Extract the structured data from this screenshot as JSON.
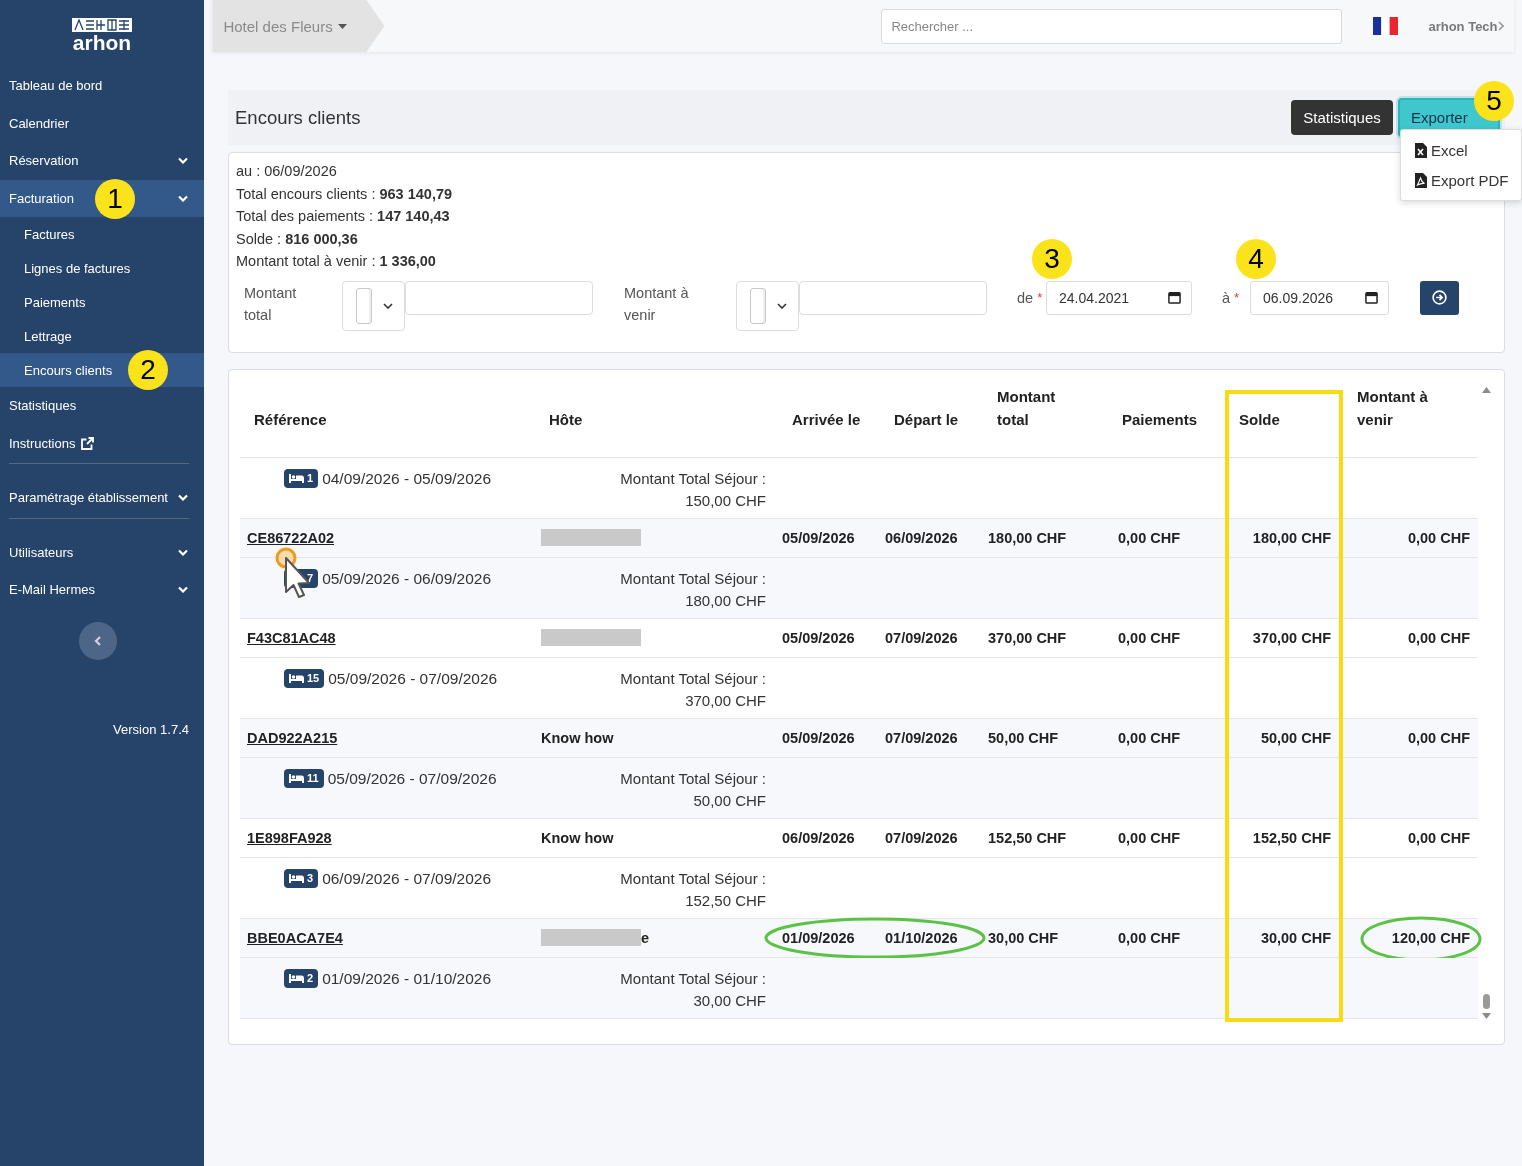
{
  "sidebar": {
    "logo": "arhon",
    "items": [
      {
        "label": "Tableau de bord",
        "kind": "link",
        "selected": false,
        "divider_before": false
      },
      {
        "label": "Calendrier",
        "kind": "link",
        "selected": false,
        "divider_before": false
      },
      {
        "label": "Réservation",
        "kind": "group",
        "selected": false,
        "divider_before": false
      },
      {
        "label": "Facturation",
        "kind": "group",
        "selected": true,
        "divider_before": false,
        "callout": "1",
        "children": [
          {
            "label": "Factures",
            "selected": false
          },
          {
            "label": "Lignes de factures",
            "selected": false
          },
          {
            "label": "Paiements",
            "selected": false
          },
          {
            "label": "Lettrage",
            "selected": false
          },
          {
            "label": "Encours clients",
            "selected": true,
            "callout": "2"
          }
        ]
      },
      {
        "label": "Statistiques",
        "kind": "link",
        "selected": false,
        "divider_before": false
      },
      {
        "label": "Instructions",
        "kind": "external",
        "selected": false,
        "divider_before": false
      },
      {
        "label": "Paramétrage établissement",
        "kind": "group",
        "selected": false,
        "divider_before": true
      },
      {
        "label": "Utilisateurs",
        "kind": "group",
        "selected": false,
        "divider_before": true
      },
      {
        "label": "E-Mail Hermes",
        "kind": "group",
        "selected": false,
        "divider_before": false
      }
    ],
    "version": "Version 1.7.4"
  },
  "topbar": {
    "hotel": "Hotel des Fleurs",
    "search": {
      "placeholder": "Rechercher ..."
    },
    "user": "arhon Tech"
  },
  "header": {
    "title": "Encours clients",
    "buttons": [
      {
        "label": "Statistiques",
        "kind": "dark"
      },
      {
        "label": "Exporter",
        "kind": "export",
        "callout": "5"
      }
    ],
    "export_menu": [
      {
        "label": "Excel",
        "kind": "excel"
      },
      {
        "label": "Export PDF",
        "kind": "pdf"
      }
    ]
  },
  "summary": {
    "lines": [
      "au : 06/09/2026",
      "Total encours clients : **963 140,79**",
      "Total des paiements : **147 140,43**",
      "Solde : **816 000,36**",
      "Montant total à venir : **1 336,00**"
    ]
  },
  "filters": {
    "amounts": [
      {
        "label": "Montant total"
      },
      {
        "label": "Montant à venir"
      }
    ],
    "dates": [
      {
        "label": "de",
        "required_mark": "*",
        "value": "24.04.2021",
        "callout": "3"
      },
      {
        "label": "à",
        "required_mark": "*",
        "value": "06.09.2026",
        "callout": "4"
      }
    ]
  },
  "table": {
    "columns": [
      {
        "label": "Référence",
        "highlighted": false
      },
      {
        "label": "Hôte",
        "highlighted": false
      },
      {
        "label": "Arrivée le",
        "highlighted": false
      },
      {
        "label": "Départ le",
        "highlighted": false
      },
      {
        "label": "Montant total",
        "highlighted": false
      },
      {
        "label": "Paiements",
        "highlighted": false
      },
      {
        "label": "Solde",
        "highlighted": true
      },
      {
        "label": "Montant à venir",
        "highlighted": false
      }
    ],
    "rows": [
      {
        "pointer": false,
        "stay": {
          "room": "1",
          "dates": "04/09/2026 - 05/09/2026",
          "label": "Montant Total Séjour :",
          "amount": "150,00 CHF"
        }
      },
      {
        "reference": "CE86722A02",
        "host_redacted": true,
        "arrival": "05/09/2026",
        "departure": "06/09/2026",
        "total": "180,00 CHF",
        "payments": "0,00 CHF",
        "balance": "180,00 CHF",
        "to_come": "0,00 CHF",
        "circled_dates": false,
        "circled_to_come": false,
        "pointer": true,
        "stay": {
          "room": "7",
          "dates": "05/09/2026 - 06/09/2026",
          "label": "Montant Total Séjour :",
          "amount": "180,00 CHF"
        }
      },
      {
        "reference": "F43C81AC48",
        "host_redacted": true,
        "arrival": "05/09/2026",
        "departure": "07/09/2026",
        "total": "370,00 CHF",
        "payments": "0,00 CHF",
        "balance": "370,00 CHF",
        "to_come": "0,00 CHF",
        "circled_dates": false,
        "circled_to_come": false,
        "pointer": false,
        "stay": {
          "room": "15",
          "dates": "05/09/2026 - 07/09/2026",
          "label": "Montant Total Séjour :",
          "amount": "370,00 CHF"
        }
      },
      {
        "reference": "DAD922A215",
        "host": "Know how",
        "host_redacted": false,
        "arrival": "05/09/2026",
        "departure": "07/09/2026",
        "total": "50,00 CHF",
        "payments": "0,00 CHF",
        "balance": "50,00 CHF",
        "to_come": "0,00 CHF",
        "circled_dates": false,
        "circled_to_come": false,
        "pointer": false,
        "stay": {
          "room": "11",
          "dates": "05/09/2026 - 07/09/2026",
          "label": "Montant Total Séjour :",
          "amount": "50,00 CHF"
        }
      },
      {
        "reference": "1E898FA928",
        "host": "Know how",
        "host_redacted": false,
        "arrival": "06/09/2026",
        "departure": "07/09/2026",
        "total": "152,50 CHF",
        "payments": "0,00 CHF",
        "balance": "152,50 CHF",
        "to_come": "0,00 CHF",
        "circled_dates": false,
        "circled_to_come": false,
        "pointer": false,
        "stay": {
          "room": "3",
          "dates": "06/09/2026 - 07/09/2026",
          "label": "Montant Total Séjour :",
          "amount": "152,50 CHF"
        }
      },
      {
        "reference": "BBE0ACA7E4",
        "host_redacted": true,
        "host_tail": "e",
        "arrival": "01/09/2026",
        "departure": "01/10/2026",
        "total": "30,00 CHF",
        "payments": "0,00 CHF",
        "balance": "30,00 CHF",
        "to_come": "120,00 CHF",
        "circled_dates": true,
        "circled_to_come": true,
        "pointer": false,
        "stay": {
          "room": "2",
          "dates": "01/09/2026 - 01/10/2026",
          "label": "Montant Total Séjour :",
          "amount": "30,00 CHF"
        }
      }
    ]
  }
}
